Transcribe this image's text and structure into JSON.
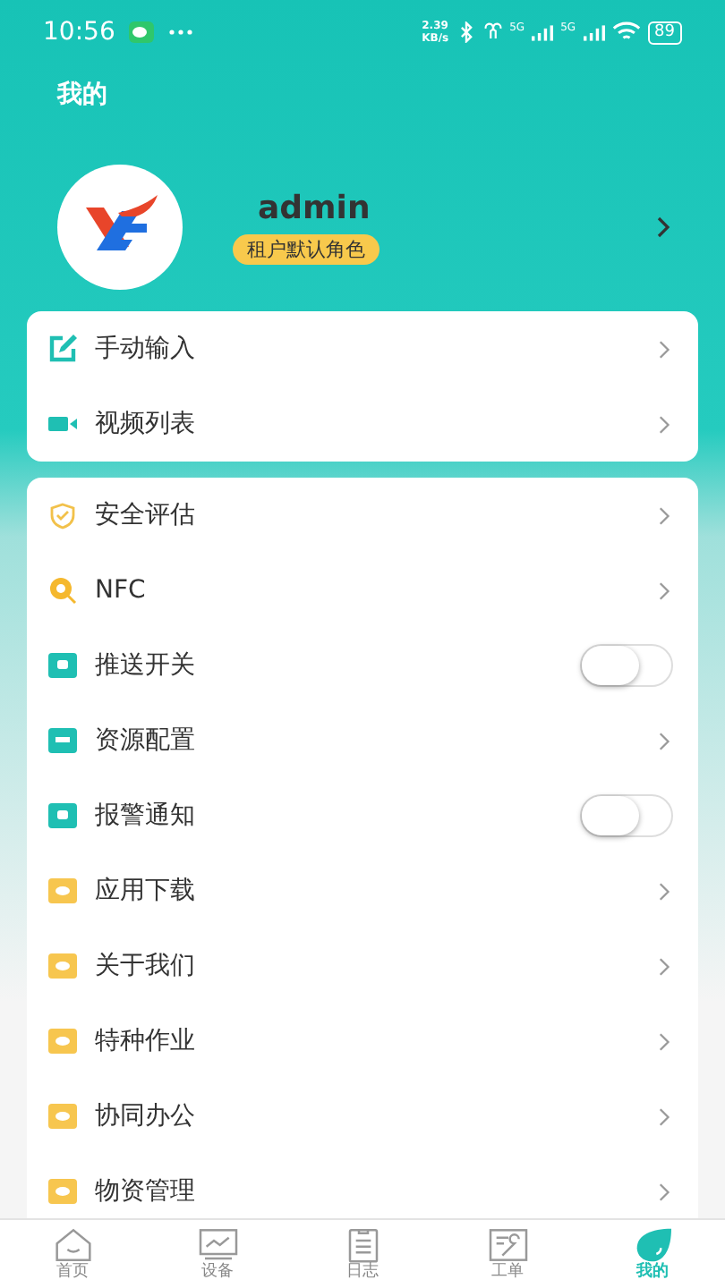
{
  "status_bar": {
    "time": "10:56",
    "speed_value": "2.39",
    "speed_unit": "KB/s",
    "network_1": "5G",
    "network_2": "5G",
    "battery": "89"
  },
  "header": {
    "title": "我的"
  },
  "profile": {
    "name": "admin",
    "role": "租户默认角色"
  },
  "top_menu": [
    {
      "label": "手动输入",
      "kind": "link"
    },
    {
      "label": "视频列表",
      "kind": "link"
    }
  ],
  "menu": [
    {
      "label": "安全评估",
      "kind": "link"
    },
    {
      "label": "NFC",
      "kind": "link"
    },
    {
      "label": "推送开关",
      "kind": "toggle",
      "on": false
    },
    {
      "label": "资源配置",
      "kind": "link"
    },
    {
      "label": "报警通知",
      "kind": "toggle",
      "on": false
    },
    {
      "label": "应用下载",
      "kind": "link"
    },
    {
      "label": "关于我们",
      "kind": "link"
    },
    {
      "label": "特种作业",
      "kind": "link"
    },
    {
      "label": "协同办公",
      "kind": "link"
    },
    {
      "label": "物资管理",
      "kind": "link"
    }
  ],
  "tab_bar": [
    {
      "label": "首页",
      "selected": false
    },
    {
      "label": "设备",
      "selected": false
    },
    {
      "label": "日志",
      "selected": false
    },
    {
      "label": "工单",
      "selected": false
    },
    {
      "label": "我的",
      "selected": true
    }
  ]
}
